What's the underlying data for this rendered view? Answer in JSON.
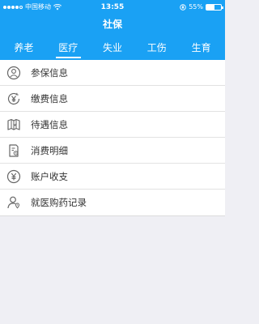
{
  "status_bar": {
    "carrier": "中国移动",
    "time": "13:55",
    "battery_percent": "55%",
    "battery_level": 0.55
  },
  "nav": {
    "title": "社保"
  },
  "tabs": [
    {
      "label": "养老",
      "active": false
    },
    {
      "label": "医疗",
      "active": true
    },
    {
      "label": "失业",
      "active": false
    },
    {
      "label": "工伤",
      "active": false
    },
    {
      "label": "生育",
      "active": false
    }
  ],
  "menu": [
    {
      "label": "参保信息",
      "icon": "user-circle-icon"
    },
    {
      "label": "缴费信息",
      "icon": "yen-circle-icon"
    },
    {
      "label": "待遇信息",
      "icon": "book-map-icon"
    },
    {
      "label": "消费明细",
      "icon": "receipt-icon"
    },
    {
      "label": "账户收支",
      "icon": "yen-balance-icon"
    },
    {
      "label": "就医购药记录",
      "icon": "user-pin-icon"
    }
  ],
  "colors": {
    "header_blue": "#1aa1f4",
    "icon_gray": "#666666"
  }
}
